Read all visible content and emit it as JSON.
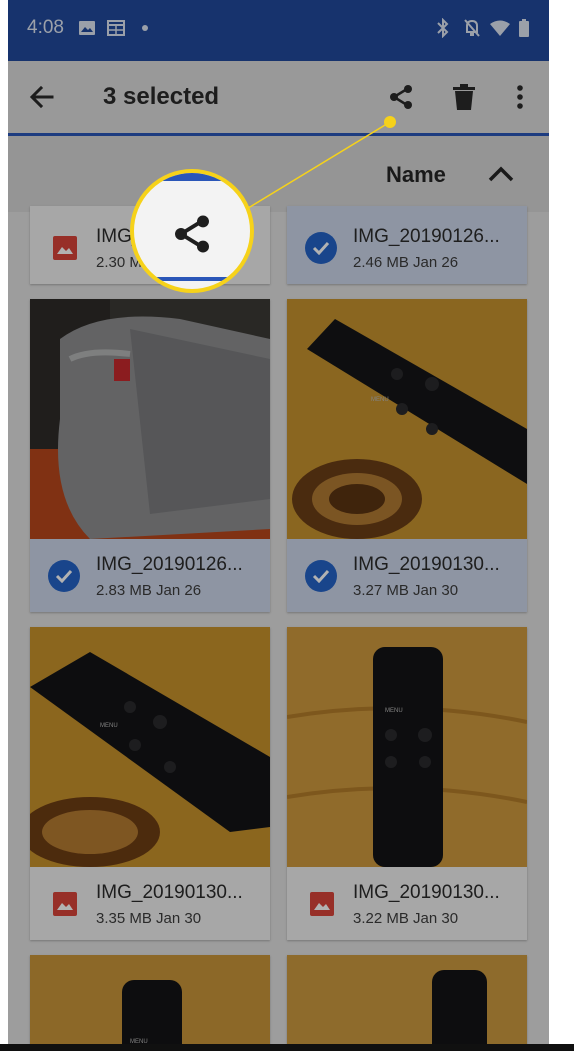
{
  "status_bar": {
    "time": "4:08",
    "icons_left": [
      "image-icon",
      "calendar-icon",
      "dot-icon"
    ],
    "icons_right": [
      "bluetooth-icon",
      "notifications-off-icon",
      "wifi-icon",
      "battery-icon"
    ]
  },
  "app_bar": {
    "title": "3 selected",
    "actions": [
      "share-icon",
      "delete-icon",
      "more-vert-icon"
    ]
  },
  "sort_bar": {
    "label": "Name",
    "direction": "ascending"
  },
  "files": [
    {
      "name": "IMG_",
      "size_date": "2.30 MB Jan 26",
      "selected": false
    },
    {
      "name": "IMG_20190126...",
      "size_date": "2.46 MB Jan 26",
      "selected": true
    },
    {
      "name": "IMG_20190126...",
      "size_date": "2.83 MB Jan 26",
      "selected": true
    },
    {
      "name": "IMG_20190130...",
      "size_date": "3.27 MB Jan 30",
      "selected": true
    },
    {
      "name": "IMG_20190130...",
      "size_date": "3.35 MB Jan 30",
      "selected": false
    },
    {
      "name": "IMG_20190130...",
      "size_date": "3.22 MB Jan 30",
      "selected": false
    }
  ],
  "thumbnails": {
    "remote_button_label": "MENU"
  },
  "colors": {
    "status_bar": "#214a9c",
    "accent": "#2a56b8",
    "check": "#2463c8",
    "callout": "#f6d21a",
    "image_icon": "#d9443a"
  }
}
